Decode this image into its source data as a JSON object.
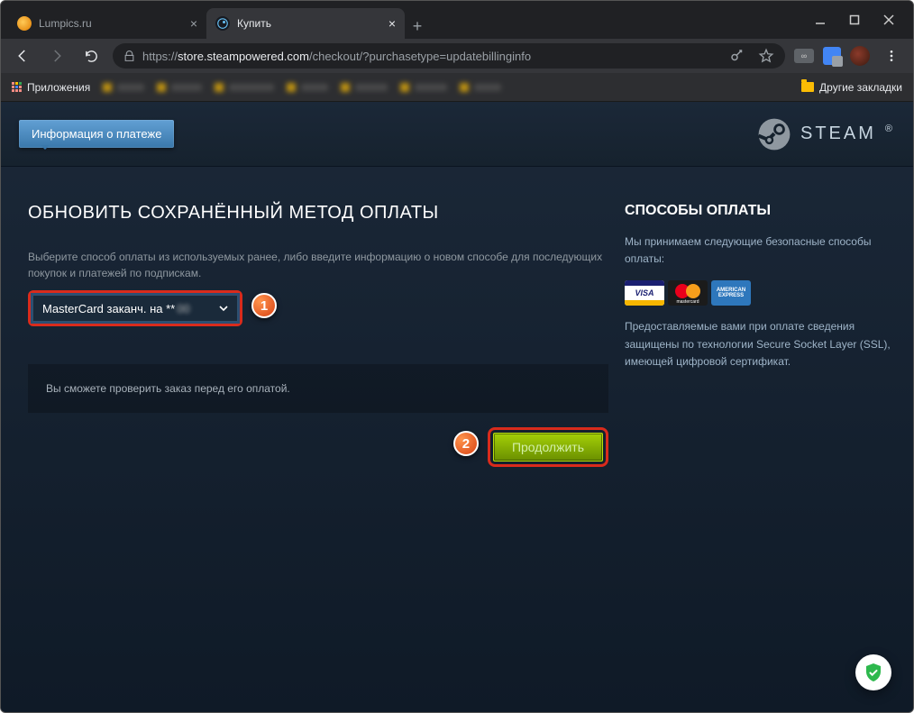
{
  "window": {
    "tabs": [
      {
        "label": "Lumpics.ru",
        "active": false
      },
      {
        "label": "Купить",
        "active": true
      }
    ]
  },
  "toolbar": {
    "url_scheme": "https://",
    "url_host": "store.steampowered.com",
    "url_path": "/checkout/?purchasetype=updatebillinginfo"
  },
  "bookmarks": {
    "apps_label": "Приложения",
    "other_label": "Другие закладки"
  },
  "breadcrumb": {
    "step1": "Информация о платеже"
  },
  "logo_text": "STEAM",
  "page": {
    "title": "ОБНОВИТЬ СОХРАНЁННЫЙ МЕТОД ОПЛАТЫ",
    "hint": "Выберите способ оплаты из используемых ранее, либо введите информацию о новом способе для последующих покупок и платежей по подпискам.",
    "select_value": "MasterCard заканч. на **",
    "review_note": "Вы сможете проверить заказ перед его оплатой.",
    "continue_label": "Продолжить",
    "callout1": "1",
    "callout2": "2"
  },
  "sidebar": {
    "title": "СПОСОБЫ ОПЛАТЫ",
    "accept_text": "Мы принимаем следующие безопасные способы оплаты:",
    "cards": {
      "visa": "VISA",
      "mc": "mastercard",
      "amex": "AMERICAN EXPRESS"
    },
    "ssl_text": "Предоставляемые вами при оплате сведения защищены по технологии Secure Socket Layer (SSL), имеющей цифровой сертификат."
  }
}
